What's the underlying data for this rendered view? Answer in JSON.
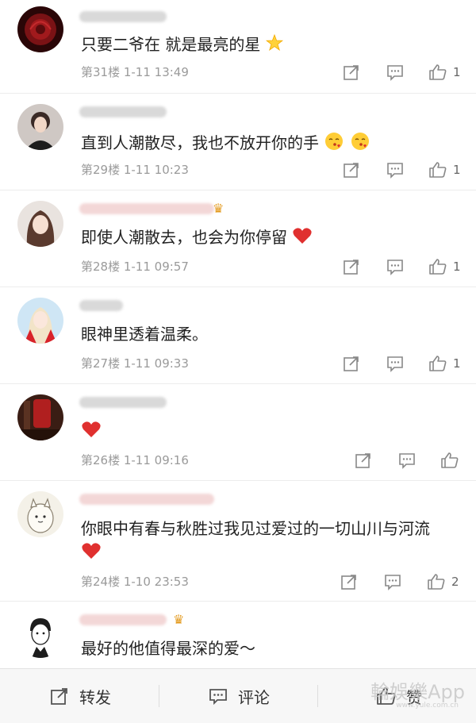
{
  "comments": [
    {
      "text": "只要二爷在 就是最亮的星",
      "meta": "第31楼 1-11 13:49",
      "likes": "1"
    },
    {
      "text": "直到人潮散尽，我也不放开你的手",
      "meta": "第29楼 1-11 10:23",
      "likes": "1"
    },
    {
      "text": "即使人潮散去，也会为你停留",
      "meta": "第28楼 1-11 09:57",
      "likes": "1"
    },
    {
      "text": "眼神里透着温柔。",
      "meta": "第27楼 1-11 09:33",
      "likes": "1"
    },
    {
      "text": "",
      "meta": "第26楼 1-11 09:16",
      "likes": ""
    },
    {
      "text": "你眼中有春与秋胜过我见过爱过的一切山川与河流",
      "meta": "第24楼 1-10 23:53",
      "likes": "2"
    },
    {
      "text": "最好的他值得最深的爱～",
      "meta": "",
      "likes": ""
    }
  ],
  "bottom_bar": {
    "repost_label": "转发",
    "comment_label": "评论",
    "like_label": "赞"
  },
  "watermark": {
    "main": "輪娛樂App",
    "sub": "www.yule.com.cn"
  },
  "colors": {
    "heart": "#e0302f",
    "crown": "#e39a1e",
    "meta_text": "#9a9a9a"
  },
  "icons": [
    "share-icon",
    "comment-icon",
    "thumbs-up-icon",
    "heart-icon",
    "star-icon",
    "kiss-emoji-icon",
    "crown-icon"
  ]
}
